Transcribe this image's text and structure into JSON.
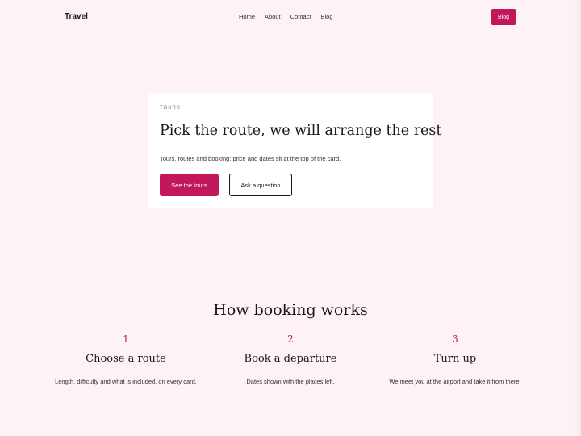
{
  "header": {
    "brand": "Travel",
    "nav": [
      "Home",
      "About",
      "Contact",
      "Blog"
    ],
    "cta": "Blog"
  },
  "hero": {
    "eyebrow": "TOURS",
    "title": "Pick the route, we will arrange the rest",
    "text": "Tours, routes and booking; price and dates sit at the top of the card.",
    "primary_button": "See the tours",
    "secondary_button": "Ask a question"
  },
  "how": {
    "title": "How booking works",
    "steps": [
      {
        "num": "1",
        "title": "Choose a route",
        "text": "Length, difficulty and what is included, on every card."
      },
      {
        "num": "2",
        "title": "Book a departure",
        "text": "Dates shown with the places left."
      },
      {
        "num": "3",
        "title": "Turn up",
        "text": "We meet you at the airport and take it from there."
      }
    ]
  },
  "colors": {
    "accent": "#c2185b",
    "background": "#fdf3f7"
  }
}
